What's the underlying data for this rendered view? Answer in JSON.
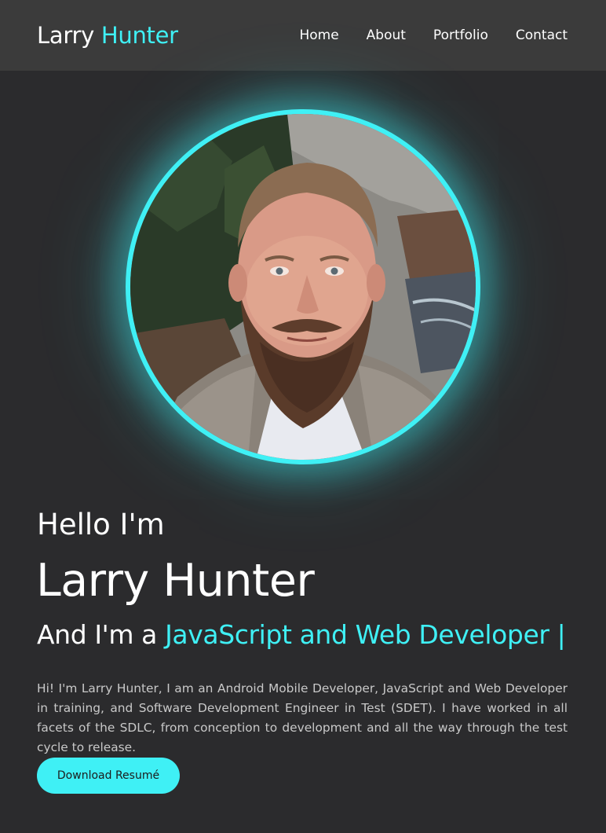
{
  "header": {
    "logo_first": "Larry",
    "logo_second": "Hunter",
    "nav": [
      "Home",
      "About",
      "Portfolio",
      "Contact"
    ]
  },
  "hero": {
    "greeting": "Hello I'm",
    "name": "Larry Hunter",
    "role_prefix": "And I'm a",
    "role_typed": "JavaScript and Web Developer |",
    "intro": "Hi! I'm Larry Hunter, I am an Android Mobile Developer, JavaScript and Web Developer in training, and Software Development Engineer in Test (SDET). I have worked in all facets of the SDLC, from conception to development and all the way through the test cycle to release.",
    "download_label": "Download Resumé"
  },
  "colors": {
    "background": "#2b2b2d",
    "header": "#3b3b3b",
    "accent": "#3ff0f5",
    "text": "#ffffff",
    "muted": "#c9c9c9"
  },
  "icons": {
    "avatar": "portrait-photo"
  }
}
